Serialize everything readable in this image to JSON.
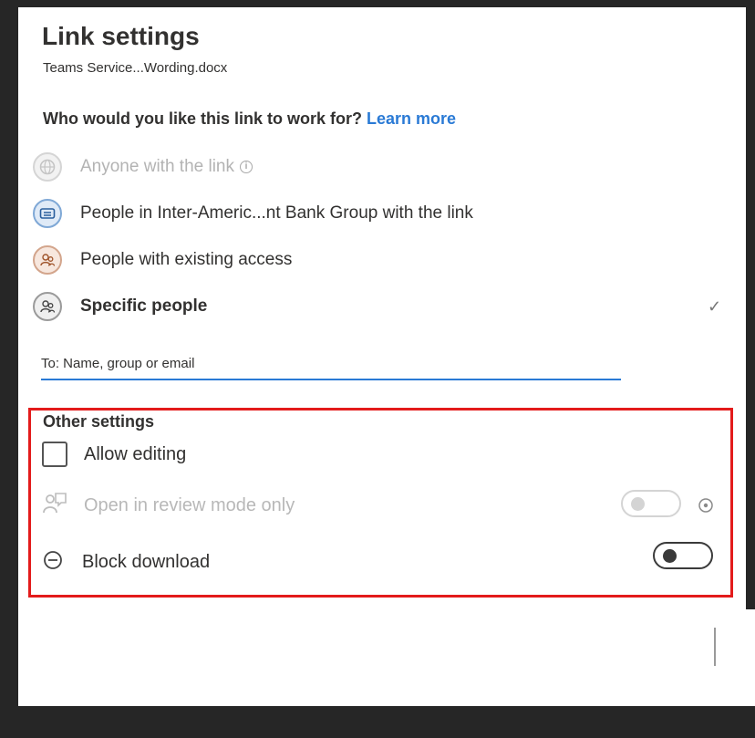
{
  "header": {
    "title": "Link settings",
    "filename": "Teams Service...Wording.docx"
  },
  "audience": {
    "question": "Who would you like this link to work for?",
    "learn_more": "Learn more",
    "options": [
      {
        "label": "Anyone with the link",
        "icon": "globe-icon",
        "state": "disabled"
      },
      {
        "label": "People in Inter-Americ...nt Bank Group with the link",
        "icon": "building-icon",
        "state": "enabled"
      },
      {
        "label": "People with existing access",
        "icon": "people-icon",
        "state": "enabled"
      },
      {
        "label": "Specific people",
        "icon": "people-icon",
        "state": "selected"
      }
    ],
    "recipient_placeholder": "To: Name, group or email"
  },
  "other_settings": {
    "title": "Other settings",
    "allow_editing": {
      "label": "Allow editing",
      "checked": false
    },
    "review_mode": {
      "label": "Open in review mode only",
      "enabled": false,
      "on": false
    },
    "block_download": {
      "label": "Block download",
      "on": false
    }
  },
  "colors": {
    "link_blue": "#2a7ad5",
    "highlight_red": "#e31b1b"
  }
}
